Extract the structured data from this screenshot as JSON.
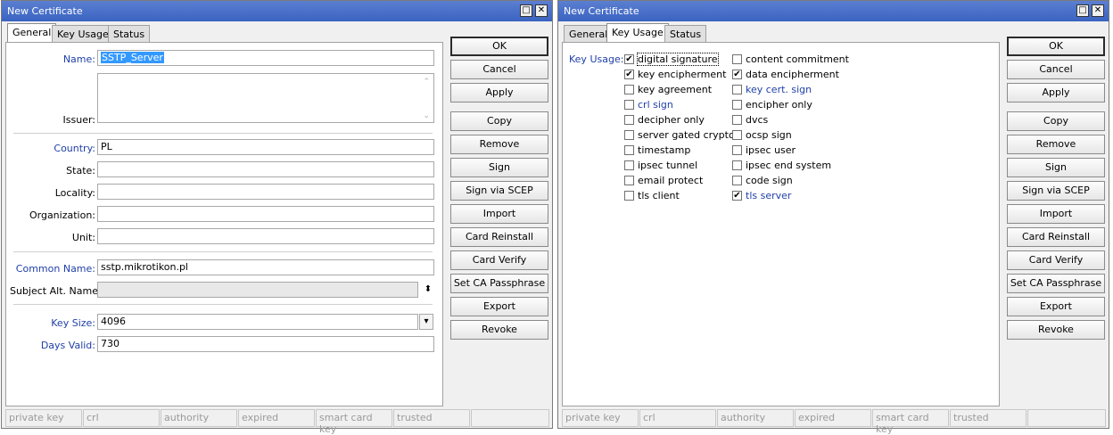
{
  "window_title": "New Certificate",
  "tabs": [
    "General",
    "Key Usage",
    "Status"
  ],
  "general": {
    "name_label": "Name:",
    "name_value": "SSTP_Server",
    "issuer_label": "Issuer:",
    "country_label": "Country:",
    "country_value": "PL",
    "state_label": "State:",
    "locality_label": "Locality:",
    "organization_label": "Organization:",
    "unit_label": "Unit:",
    "common_name_label": "Common Name:",
    "common_name_value": "sstp.mikrotikon.pl",
    "subject_alt_label": "Subject Alt. Name:",
    "key_size_label": "Key Size:",
    "key_size_value": "4096",
    "days_valid_label": "Days Valid:",
    "days_valid_value": "730"
  },
  "key_usage": {
    "label": "Key Usage:",
    "left": [
      {
        "label": "digital signature",
        "checked": true,
        "blue": false
      },
      {
        "label": "key encipherment",
        "checked": true,
        "blue": false
      },
      {
        "label": "key agreement",
        "checked": false,
        "blue": false
      },
      {
        "label": "crl sign",
        "checked": false,
        "blue": true
      },
      {
        "label": "decipher only",
        "checked": false,
        "blue": false
      },
      {
        "label": "server gated crypto",
        "checked": false,
        "blue": false
      },
      {
        "label": "timestamp",
        "checked": false,
        "blue": false
      },
      {
        "label": "ipsec tunnel",
        "checked": false,
        "blue": false
      },
      {
        "label": "email protect",
        "checked": false,
        "blue": false
      },
      {
        "label": "tls client",
        "checked": false,
        "blue": false
      }
    ],
    "right": [
      {
        "label": "content commitment",
        "checked": false,
        "blue": false
      },
      {
        "label": "data encipherment",
        "checked": true,
        "blue": false
      },
      {
        "label": "key cert. sign",
        "checked": false,
        "blue": true
      },
      {
        "label": "encipher only",
        "checked": false,
        "blue": false
      },
      {
        "label": "dvcs",
        "checked": false,
        "blue": false
      },
      {
        "label": "ocsp sign",
        "checked": false,
        "blue": false
      },
      {
        "label": "ipsec user",
        "checked": false,
        "blue": false
      },
      {
        "label": "ipsec end system",
        "checked": false,
        "blue": false
      },
      {
        "label": "code sign",
        "checked": false,
        "blue": false
      },
      {
        "label": "tls server",
        "checked": true,
        "blue": true
      }
    ]
  },
  "buttons": [
    "OK",
    "Cancel",
    "Apply",
    "Copy",
    "Remove",
    "Sign",
    "Sign via SCEP",
    "Import",
    "Card Reinstall",
    "Card Verify",
    "Set CA Passphrase",
    "Export",
    "Revoke"
  ],
  "status_cells": [
    "private key",
    "crl",
    "authority",
    "expired",
    "smart card key",
    "trusted"
  ],
  "colors": {
    "label_blue": "#1f3fa8",
    "title_blue": "#3a63c2",
    "selection": "#3399ff"
  }
}
